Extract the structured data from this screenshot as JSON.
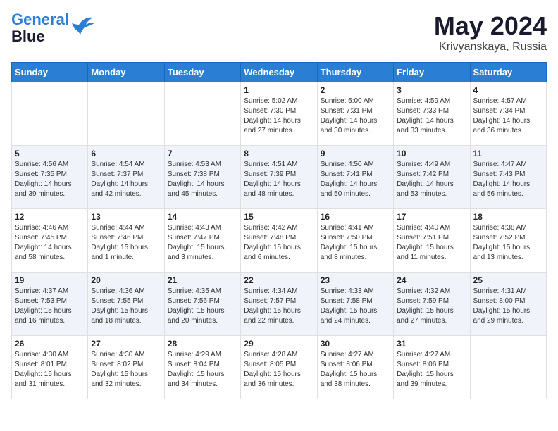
{
  "logo": {
    "line1": "General",
    "line2": "Blue"
  },
  "title": "May 2024",
  "location": "Krivyanskaya, Russia",
  "days_of_week": [
    "Sunday",
    "Monday",
    "Tuesday",
    "Wednesday",
    "Thursday",
    "Friday",
    "Saturday"
  ],
  "weeks": [
    [
      {
        "day": "",
        "info": ""
      },
      {
        "day": "",
        "info": ""
      },
      {
        "day": "",
        "info": ""
      },
      {
        "day": "1",
        "info": "Sunrise: 5:02 AM\nSunset: 7:30 PM\nDaylight: 14 hours\nand 27 minutes."
      },
      {
        "day": "2",
        "info": "Sunrise: 5:00 AM\nSunset: 7:31 PM\nDaylight: 14 hours\nand 30 minutes."
      },
      {
        "day": "3",
        "info": "Sunrise: 4:59 AM\nSunset: 7:33 PM\nDaylight: 14 hours\nand 33 minutes."
      },
      {
        "day": "4",
        "info": "Sunrise: 4:57 AM\nSunset: 7:34 PM\nDaylight: 14 hours\nand 36 minutes."
      }
    ],
    [
      {
        "day": "5",
        "info": "Sunrise: 4:56 AM\nSunset: 7:35 PM\nDaylight: 14 hours\nand 39 minutes."
      },
      {
        "day": "6",
        "info": "Sunrise: 4:54 AM\nSunset: 7:37 PM\nDaylight: 14 hours\nand 42 minutes."
      },
      {
        "day": "7",
        "info": "Sunrise: 4:53 AM\nSunset: 7:38 PM\nDaylight: 14 hours\nand 45 minutes."
      },
      {
        "day": "8",
        "info": "Sunrise: 4:51 AM\nSunset: 7:39 PM\nDaylight: 14 hours\nand 48 minutes."
      },
      {
        "day": "9",
        "info": "Sunrise: 4:50 AM\nSunset: 7:41 PM\nDaylight: 14 hours\nand 50 minutes."
      },
      {
        "day": "10",
        "info": "Sunrise: 4:49 AM\nSunset: 7:42 PM\nDaylight: 14 hours\nand 53 minutes."
      },
      {
        "day": "11",
        "info": "Sunrise: 4:47 AM\nSunset: 7:43 PM\nDaylight: 14 hours\nand 56 minutes."
      }
    ],
    [
      {
        "day": "12",
        "info": "Sunrise: 4:46 AM\nSunset: 7:45 PM\nDaylight: 14 hours\nand 58 minutes."
      },
      {
        "day": "13",
        "info": "Sunrise: 4:44 AM\nSunset: 7:46 PM\nDaylight: 15 hours\nand 1 minute."
      },
      {
        "day": "14",
        "info": "Sunrise: 4:43 AM\nSunset: 7:47 PM\nDaylight: 15 hours\nand 3 minutes."
      },
      {
        "day": "15",
        "info": "Sunrise: 4:42 AM\nSunset: 7:48 PM\nDaylight: 15 hours\nand 6 minutes."
      },
      {
        "day": "16",
        "info": "Sunrise: 4:41 AM\nSunset: 7:50 PM\nDaylight: 15 hours\nand 8 minutes."
      },
      {
        "day": "17",
        "info": "Sunrise: 4:40 AM\nSunset: 7:51 PM\nDaylight: 15 hours\nand 11 minutes."
      },
      {
        "day": "18",
        "info": "Sunrise: 4:38 AM\nSunset: 7:52 PM\nDaylight: 15 hours\nand 13 minutes."
      }
    ],
    [
      {
        "day": "19",
        "info": "Sunrise: 4:37 AM\nSunset: 7:53 PM\nDaylight: 15 hours\nand 16 minutes."
      },
      {
        "day": "20",
        "info": "Sunrise: 4:36 AM\nSunset: 7:55 PM\nDaylight: 15 hours\nand 18 minutes."
      },
      {
        "day": "21",
        "info": "Sunrise: 4:35 AM\nSunset: 7:56 PM\nDaylight: 15 hours\nand 20 minutes."
      },
      {
        "day": "22",
        "info": "Sunrise: 4:34 AM\nSunset: 7:57 PM\nDaylight: 15 hours\nand 22 minutes."
      },
      {
        "day": "23",
        "info": "Sunrise: 4:33 AM\nSunset: 7:58 PM\nDaylight: 15 hours\nand 24 minutes."
      },
      {
        "day": "24",
        "info": "Sunrise: 4:32 AM\nSunset: 7:59 PM\nDaylight: 15 hours\nand 27 minutes."
      },
      {
        "day": "25",
        "info": "Sunrise: 4:31 AM\nSunset: 8:00 PM\nDaylight: 15 hours\nand 29 minutes."
      }
    ],
    [
      {
        "day": "26",
        "info": "Sunrise: 4:30 AM\nSunset: 8:01 PM\nDaylight: 15 hours\nand 31 minutes."
      },
      {
        "day": "27",
        "info": "Sunrise: 4:30 AM\nSunset: 8:02 PM\nDaylight: 15 hours\nand 32 minutes."
      },
      {
        "day": "28",
        "info": "Sunrise: 4:29 AM\nSunset: 8:04 PM\nDaylight: 15 hours\nand 34 minutes."
      },
      {
        "day": "29",
        "info": "Sunrise: 4:28 AM\nSunset: 8:05 PM\nDaylight: 15 hours\nand 36 minutes."
      },
      {
        "day": "30",
        "info": "Sunrise: 4:27 AM\nSunset: 8:06 PM\nDaylight: 15 hours\nand 38 minutes."
      },
      {
        "day": "31",
        "info": "Sunrise: 4:27 AM\nSunset: 8:06 PM\nDaylight: 15 hours\nand 39 minutes."
      },
      {
        "day": "",
        "info": ""
      }
    ]
  ]
}
